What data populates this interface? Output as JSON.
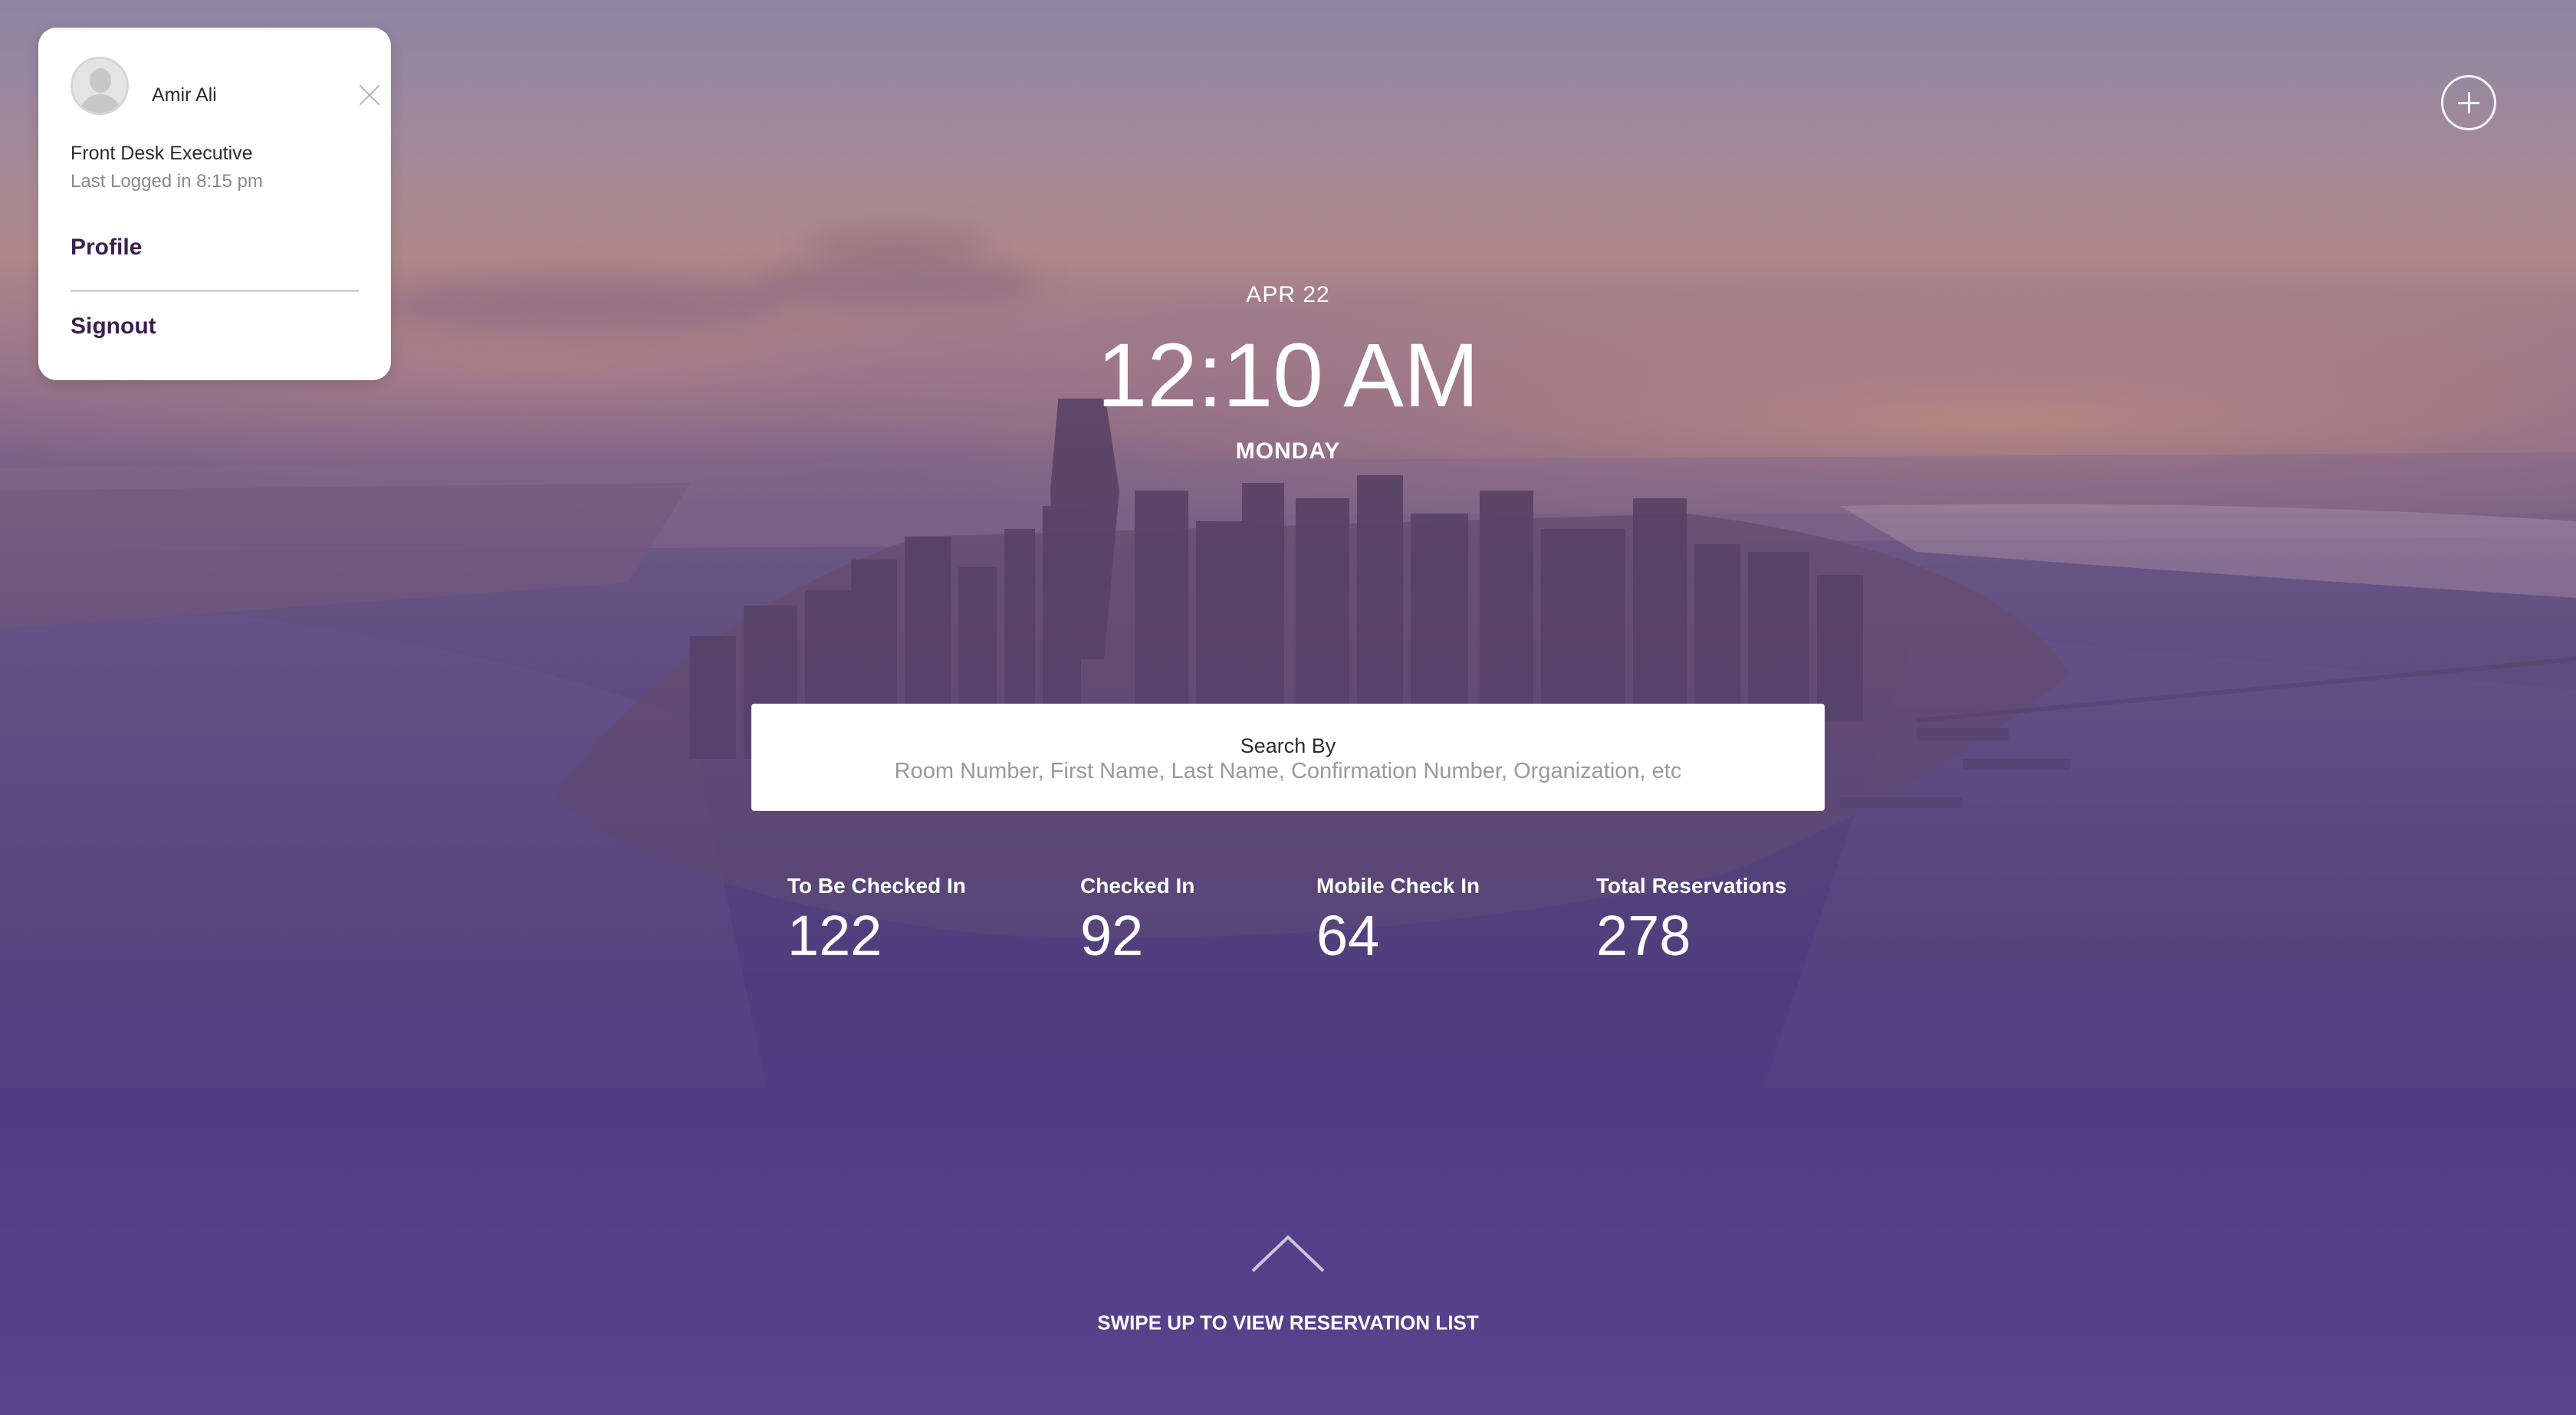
{
  "user": {
    "name": "Amir Ali",
    "role": "Front Desk Executive",
    "last_login": "Last Logged in 8:15 pm"
  },
  "menu": {
    "profile_label": "Profile",
    "signout_label": "Signout"
  },
  "clock": {
    "date": "APR 22",
    "time": "12:10 AM",
    "day": "MONDAY"
  },
  "search": {
    "label": "Search By",
    "placeholder": "Room Number, First Name, Last Name, Confirmation Number, Organization, etc"
  },
  "stats": [
    {
      "label": "To Be Checked In",
      "value": "122"
    },
    {
      "label": "Checked In",
      "value": "92"
    },
    {
      "label": "Mobile Check In",
      "value": "64"
    },
    {
      "label": "Total Reservations",
      "value": "278"
    }
  ],
  "footer": {
    "swipe_text": "SWIPE UP TO VIEW RESERVATION LIST"
  },
  "icons": {
    "avatar": "user-avatar-icon",
    "close": "close-icon",
    "add": "plus-circle-icon",
    "swipe": "chevron-up-icon"
  },
  "colors": {
    "accent": "#3b1f4e",
    "overlay": "#4e3f78"
  }
}
